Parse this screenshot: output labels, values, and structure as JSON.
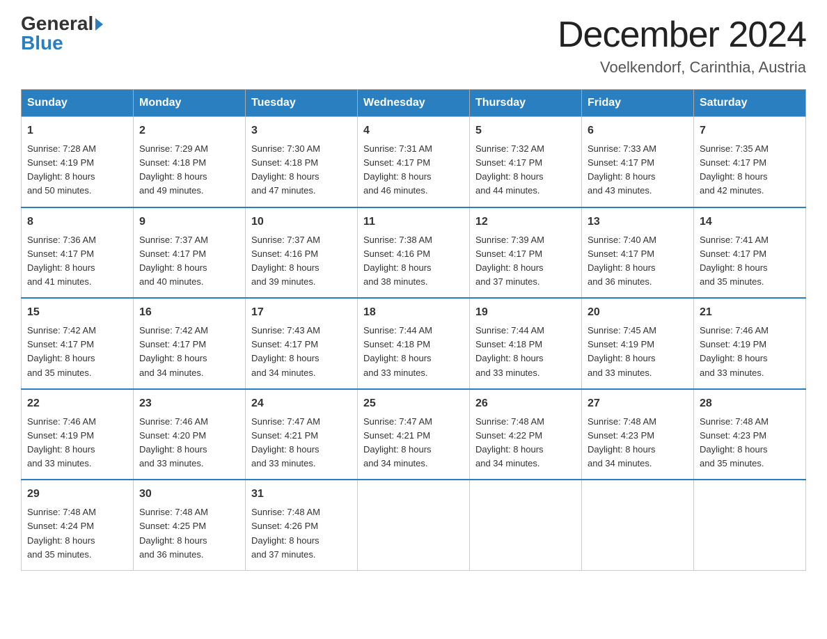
{
  "header": {
    "logo": {
      "general": "General",
      "blue": "Blue"
    },
    "title": "December 2024",
    "location": "Voelkendorf, Carinthia, Austria"
  },
  "calendar": {
    "weekdays": [
      "Sunday",
      "Monday",
      "Tuesday",
      "Wednesday",
      "Thursday",
      "Friday",
      "Saturday"
    ],
    "weeks": [
      [
        {
          "day": "1",
          "sunrise": "7:28 AM",
          "sunset": "4:19 PM",
          "daylight": "8 hours and 50 minutes."
        },
        {
          "day": "2",
          "sunrise": "7:29 AM",
          "sunset": "4:18 PM",
          "daylight": "8 hours and 49 minutes."
        },
        {
          "day": "3",
          "sunrise": "7:30 AM",
          "sunset": "4:18 PM",
          "daylight": "8 hours and 47 minutes."
        },
        {
          "day": "4",
          "sunrise": "7:31 AM",
          "sunset": "4:17 PM",
          "daylight": "8 hours and 46 minutes."
        },
        {
          "day": "5",
          "sunrise": "7:32 AM",
          "sunset": "4:17 PM",
          "daylight": "8 hours and 44 minutes."
        },
        {
          "day": "6",
          "sunrise": "7:33 AM",
          "sunset": "4:17 PM",
          "daylight": "8 hours and 43 minutes."
        },
        {
          "day": "7",
          "sunrise": "7:35 AM",
          "sunset": "4:17 PM",
          "daylight": "8 hours and 42 minutes."
        }
      ],
      [
        {
          "day": "8",
          "sunrise": "7:36 AM",
          "sunset": "4:17 PM",
          "daylight": "8 hours and 41 minutes."
        },
        {
          "day": "9",
          "sunrise": "7:37 AM",
          "sunset": "4:17 PM",
          "daylight": "8 hours and 40 minutes."
        },
        {
          "day": "10",
          "sunrise": "7:37 AM",
          "sunset": "4:16 PM",
          "daylight": "8 hours and 39 minutes."
        },
        {
          "day": "11",
          "sunrise": "7:38 AM",
          "sunset": "4:16 PM",
          "daylight": "8 hours and 38 minutes."
        },
        {
          "day": "12",
          "sunrise": "7:39 AM",
          "sunset": "4:17 PM",
          "daylight": "8 hours and 37 minutes."
        },
        {
          "day": "13",
          "sunrise": "7:40 AM",
          "sunset": "4:17 PM",
          "daylight": "8 hours and 36 minutes."
        },
        {
          "day": "14",
          "sunrise": "7:41 AM",
          "sunset": "4:17 PM",
          "daylight": "8 hours and 35 minutes."
        }
      ],
      [
        {
          "day": "15",
          "sunrise": "7:42 AM",
          "sunset": "4:17 PM",
          "daylight": "8 hours and 35 minutes."
        },
        {
          "day": "16",
          "sunrise": "7:42 AM",
          "sunset": "4:17 PM",
          "daylight": "8 hours and 34 minutes."
        },
        {
          "day": "17",
          "sunrise": "7:43 AM",
          "sunset": "4:17 PM",
          "daylight": "8 hours and 34 minutes."
        },
        {
          "day": "18",
          "sunrise": "7:44 AM",
          "sunset": "4:18 PM",
          "daylight": "8 hours and 33 minutes."
        },
        {
          "day": "19",
          "sunrise": "7:44 AM",
          "sunset": "4:18 PM",
          "daylight": "8 hours and 33 minutes."
        },
        {
          "day": "20",
          "sunrise": "7:45 AM",
          "sunset": "4:19 PM",
          "daylight": "8 hours and 33 minutes."
        },
        {
          "day": "21",
          "sunrise": "7:46 AM",
          "sunset": "4:19 PM",
          "daylight": "8 hours and 33 minutes."
        }
      ],
      [
        {
          "day": "22",
          "sunrise": "7:46 AM",
          "sunset": "4:19 PM",
          "daylight": "8 hours and 33 minutes."
        },
        {
          "day": "23",
          "sunrise": "7:46 AM",
          "sunset": "4:20 PM",
          "daylight": "8 hours and 33 minutes."
        },
        {
          "day": "24",
          "sunrise": "7:47 AM",
          "sunset": "4:21 PM",
          "daylight": "8 hours and 33 minutes."
        },
        {
          "day": "25",
          "sunrise": "7:47 AM",
          "sunset": "4:21 PM",
          "daylight": "8 hours and 34 minutes."
        },
        {
          "day": "26",
          "sunrise": "7:48 AM",
          "sunset": "4:22 PM",
          "daylight": "8 hours and 34 minutes."
        },
        {
          "day": "27",
          "sunrise": "7:48 AM",
          "sunset": "4:23 PM",
          "daylight": "8 hours and 34 minutes."
        },
        {
          "day": "28",
          "sunrise": "7:48 AM",
          "sunset": "4:23 PM",
          "daylight": "8 hours and 35 minutes."
        }
      ],
      [
        {
          "day": "29",
          "sunrise": "7:48 AM",
          "sunset": "4:24 PM",
          "daylight": "8 hours and 35 minutes."
        },
        {
          "day": "30",
          "sunrise": "7:48 AM",
          "sunset": "4:25 PM",
          "daylight": "8 hours and 36 minutes."
        },
        {
          "day": "31",
          "sunrise": "7:48 AM",
          "sunset": "4:26 PM",
          "daylight": "8 hours and 37 minutes."
        },
        null,
        null,
        null,
        null
      ]
    ],
    "sunrise_label": "Sunrise:",
    "sunset_label": "Sunset:",
    "daylight_label": "Daylight:"
  }
}
